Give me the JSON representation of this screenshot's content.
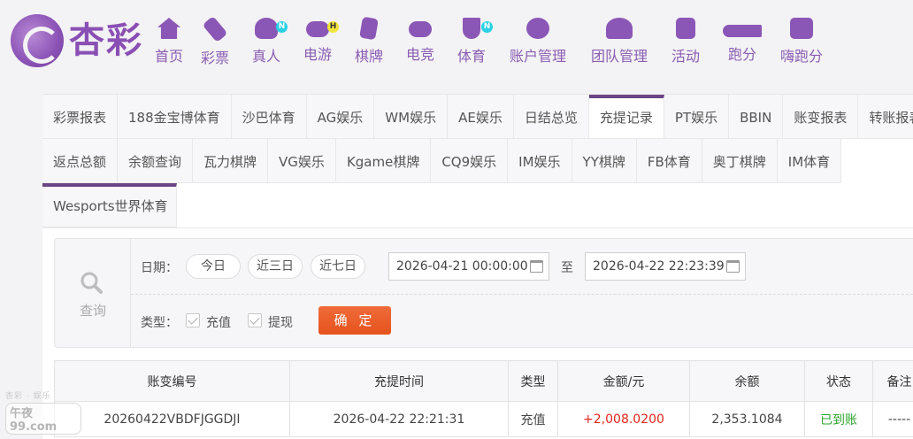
{
  "brand": {
    "logo_text": "杏彩"
  },
  "nav": [
    {
      "label": "首页",
      "icon": "home-icon",
      "badge": ""
    },
    {
      "label": "彩票",
      "icon": "lottery-ticket-icon",
      "badge": ""
    },
    {
      "label": "真人",
      "icon": "live-dealer-icon",
      "badge": "N"
    },
    {
      "label": "电游",
      "icon": "gamepad-icon",
      "badge": "H"
    },
    {
      "label": "棋牌",
      "icon": "cards-icon",
      "badge": ""
    },
    {
      "label": "电竞",
      "icon": "esports-controller-icon",
      "badge": ""
    },
    {
      "label": "体育",
      "icon": "trophy-icon",
      "badge": "N"
    },
    {
      "label": "账户管理",
      "icon": "account-icon",
      "badge": ""
    },
    {
      "label": "团队管理",
      "icon": "team-icon",
      "badge": ""
    },
    {
      "label": "活动",
      "icon": "gift-icon",
      "badge": ""
    },
    {
      "label": "跑分",
      "icon": "running-icon",
      "badge": ""
    },
    {
      "label": "嗨跑分",
      "icon": "hi-icon",
      "badge": ""
    }
  ],
  "tabs_row1": [
    "彩票报表",
    "188金宝博体育",
    "沙巴体育",
    "AG娱乐",
    "WM娱乐",
    "AE娱乐",
    "日结总览",
    "充提记录",
    "PT娱乐",
    "BBIN",
    "账变报表",
    "转账报表"
  ],
  "tabs_row2": [
    "返点总额",
    "余额查询",
    "瓦力棋牌",
    "VG娱乐",
    "Kgame棋牌",
    "CQ9娱乐",
    "IM娱乐",
    "YY棋牌",
    "FB体育",
    "奥丁棋牌",
    "IM体育"
  ],
  "tabs_row3": [
    "Wesports世界体育"
  ],
  "active_tab": "充提记录",
  "filter": {
    "query_label": "查询",
    "date_label": "日期：",
    "quick_today": "今日",
    "quick_3days": "近三日",
    "quick_7days": "近七日",
    "date_from": "2026-04-21 00:00:00",
    "to_label": "至",
    "date_to": "2026-04-22 22:23:39",
    "type_label": "类型：",
    "type_deposit": "充值",
    "type_withdraw": "提现",
    "confirm": "确 定"
  },
  "table": {
    "columns": [
      "账变编号",
      "充提时间",
      "类型",
      "金额/元",
      "余额",
      "状态",
      "备注"
    ],
    "rows": [
      [
        "20260422VBDFJGGDJI",
        "2026-04-22 22:21:31",
        "充值",
        "+2,008.0200",
        "2,353.1084",
        "已到账",
        "-----"
      ]
    ]
  },
  "watermark": {
    "top": "杏彩 · 娱乐",
    "main": "午夜99.com"
  }
}
